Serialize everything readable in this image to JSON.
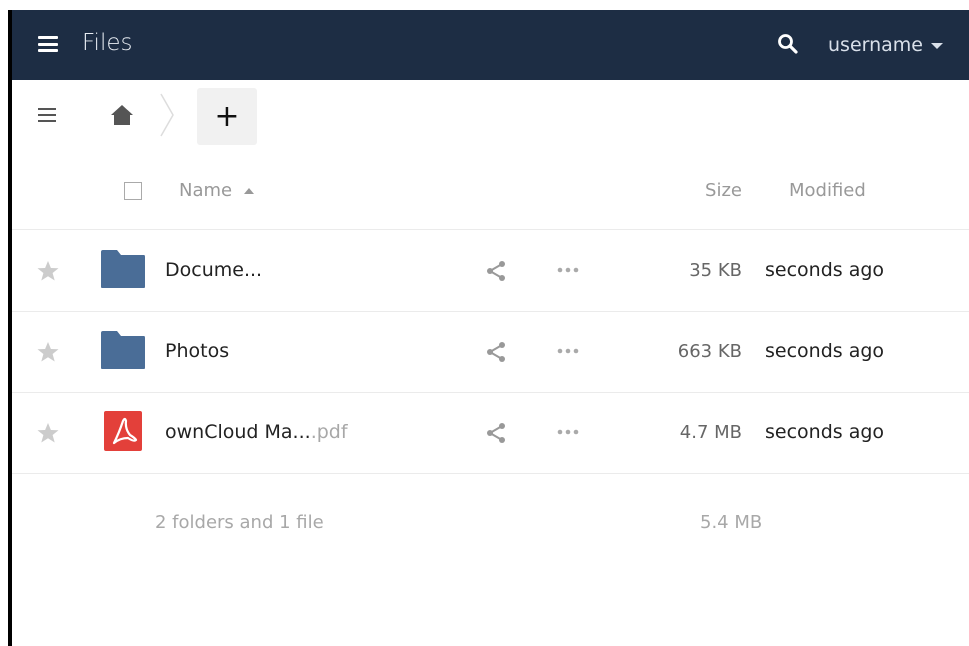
{
  "header": {
    "title": "Files",
    "username": "username",
    "colors": {
      "background": "#1d2d44"
    }
  },
  "controls": {
    "new_label": "+"
  },
  "table": {
    "headers": {
      "name": "Name",
      "size": "Size",
      "modified": "Modified"
    },
    "rows": [
      {
        "name": "Docume...",
        "ext": "",
        "type": "folder",
        "size": "35 KB",
        "modified": "seconds ago"
      },
      {
        "name": "Photos",
        "ext": "",
        "type": "folder",
        "size": "663 KB",
        "modified": "seconds ago"
      },
      {
        "name": "ownCloud Ma...",
        "ext": ".pdf",
        "type": "pdf",
        "size": "4.7 MB",
        "modified": "seconds ago"
      }
    ]
  },
  "summary": {
    "text": "2 folders and 1 file",
    "size": "5.4 MB"
  },
  "icons": {
    "menu": "hamburger-icon",
    "search": "search-icon",
    "home": "home-icon",
    "star": "star-icon",
    "folder": "folder-icon",
    "pdf": "pdf-icon",
    "share": "share-icon",
    "more": "more-icon"
  },
  "colors": {
    "folder": "#4a6d97",
    "pdf": "#e3403a",
    "muted": "#a8a8a8"
  }
}
